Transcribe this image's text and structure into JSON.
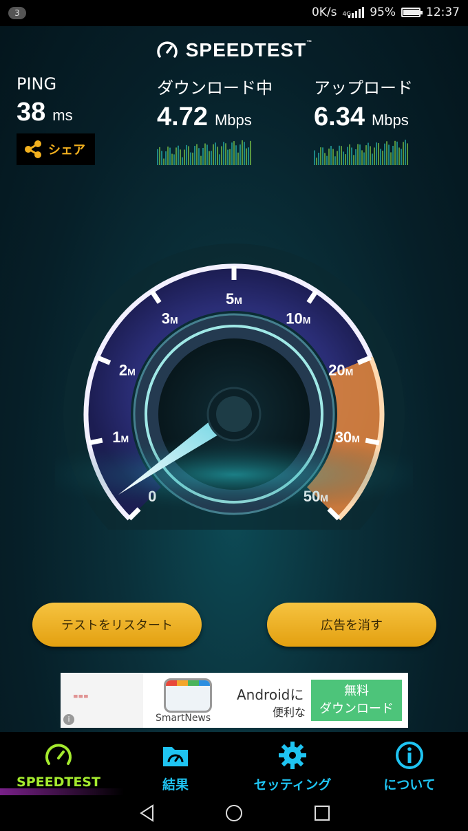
{
  "status_bar": {
    "notification_count": "3",
    "net_speed": "0K/s",
    "network_type": "4G",
    "battery": "95%",
    "battery_level": 0.95,
    "time": "12:37"
  },
  "app": {
    "brand": "SPEEDTEST",
    "trademark": "™"
  },
  "results": {
    "ping": {
      "label": "PING",
      "value": "38",
      "unit": "ms"
    },
    "download": {
      "label": "ダウンロード中",
      "value": "4.72",
      "unit": "Mbps"
    },
    "upload": {
      "label": "アップロード",
      "value": "6.34",
      "unit": "Mbps"
    }
  },
  "share": {
    "label": "シェア",
    "icon": "share-icon"
  },
  "gauge": {
    "scale_labels": [
      {
        "num": "0",
        "unit": ""
      },
      {
        "num": "1",
        "unit": "M"
      },
      {
        "num": "2",
        "unit": "M"
      },
      {
        "num": "3",
        "unit": "M"
      },
      {
        "num": "5",
        "unit": "M"
      },
      {
        "num": "10",
        "unit": "M"
      },
      {
        "num": "20",
        "unit": "M"
      },
      {
        "num": "30",
        "unit": "M"
      },
      {
        "num": "50",
        "unit": "M"
      }
    ],
    "needle_value_mbps": 0.3,
    "colors": {
      "track": "#8a6ee0",
      "high_range": "#e8893a"
    }
  },
  "actions": {
    "restart": "テストをリスタート",
    "remove_ads": "広告を消す"
  },
  "ad": {
    "brand": "SmartNews",
    "line1": "Androidに",
    "line2": "便利な",
    "cta_line1": "無料",
    "cta_line2": "ダウンロード",
    "info": "i"
  },
  "tabs": [
    {
      "label": "SPEEDTEST",
      "icon": "speedometer-icon",
      "active": true
    },
    {
      "label": "結果",
      "icon": "results-folder-icon",
      "active": false
    },
    {
      "label": "セッティング",
      "icon": "gear-icon",
      "active": false
    },
    {
      "label": "について",
      "icon": "info-icon",
      "active": false
    }
  ],
  "nav": {
    "back": "back-icon",
    "home": "home-icon",
    "recents": "recents-icon"
  }
}
